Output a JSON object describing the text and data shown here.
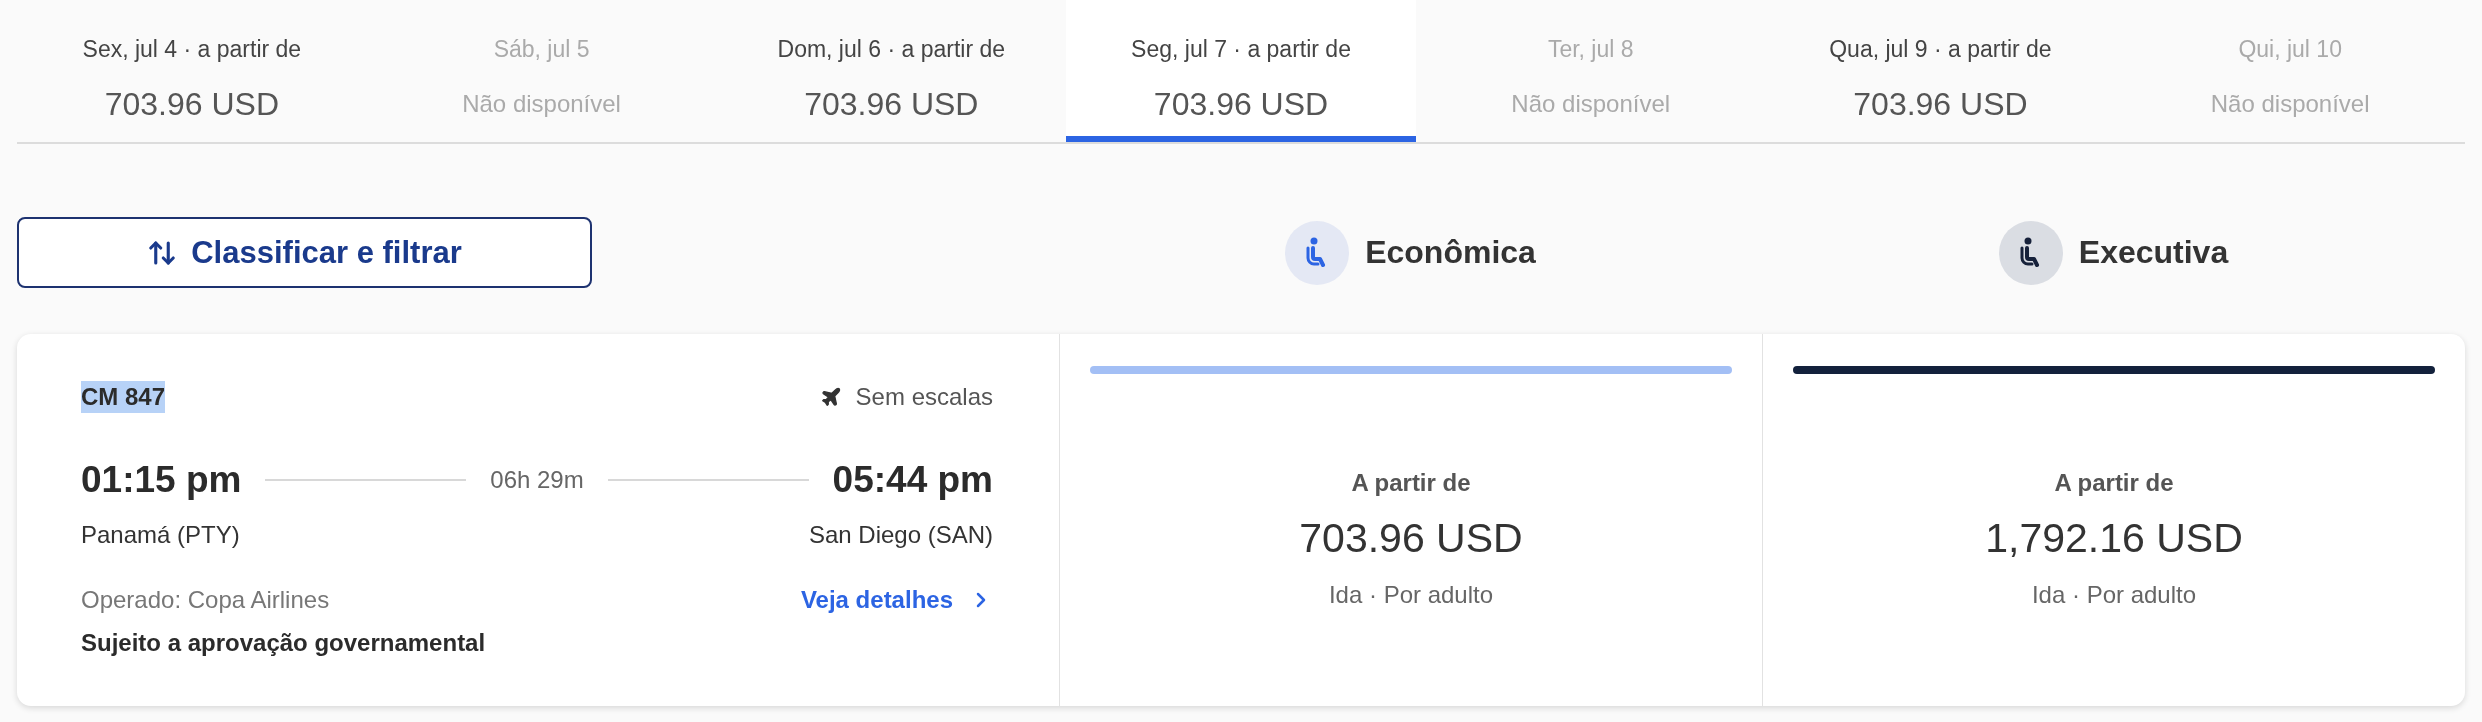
{
  "date_tabs": [
    {
      "label": "Sex, jul 4 · a partir de",
      "value": "703.96 USD",
      "available": true,
      "selected": false
    },
    {
      "label": "Sáb, jul 5",
      "value": "Não disponível",
      "available": false,
      "selected": false
    },
    {
      "label": "Dom, jul 6 · a partir de",
      "value": "703.96 USD",
      "available": true,
      "selected": false
    },
    {
      "label": "Seg, jul 7 · a partir de",
      "value": "703.96 USD",
      "available": true,
      "selected": true
    },
    {
      "label": "Ter, jul 8",
      "value": "Não disponível",
      "available": false,
      "selected": false
    },
    {
      "label": "Qua, jul 9 · a partir de",
      "value": "703.96 USD",
      "available": true,
      "selected": false
    },
    {
      "label": "Qui, jul 10",
      "value": "Não disponível",
      "available": false,
      "selected": false
    }
  ],
  "filter_button": {
    "label": "Classificar e filtrar"
  },
  "flight": {
    "flight_number": {
      "text": "CM 847",
      "highlighted": true
    },
    "stops": "Sem escalas",
    "departure": {
      "time": "01:15 pm",
      "airport": "Panamá (PTY)"
    },
    "duration": "06h 29m",
    "arrival": {
      "time": "05:44 pm",
      "airport": "San Diego (SAN)"
    },
    "operator": "Operado: Copa Airlines",
    "details_link": "Veja detalhes",
    "notice": "Sujeito a aprovação governamental"
  },
  "cabins": [
    {
      "kind": "economy",
      "name": "Econômica",
      "color": "#a3bff5",
      "fare": {
        "caption": "A partir de",
        "price": "703.96 USD",
        "note": "Ida · Por adulto"
      }
    },
    {
      "kind": "business",
      "name": "Executiva",
      "color": "#13213c",
      "fare": {
        "caption": "A partir de",
        "price": "1,792.16 USD",
        "note": "Ida · Por adulto"
      }
    }
  ]
}
